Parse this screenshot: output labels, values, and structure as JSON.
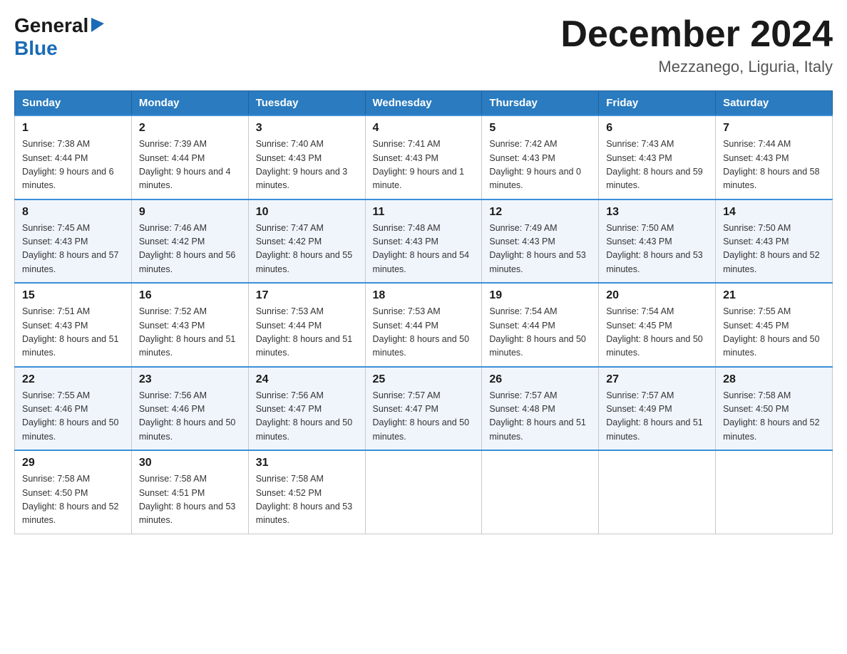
{
  "header": {
    "logo_general": "General",
    "logo_blue": "Blue",
    "month_title": "December 2024",
    "location": "Mezzanego, Liguria, Italy"
  },
  "days_of_week": [
    "Sunday",
    "Monday",
    "Tuesday",
    "Wednesday",
    "Thursday",
    "Friday",
    "Saturday"
  ],
  "weeks": [
    [
      {
        "day": "1",
        "sunrise": "7:38 AM",
        "sunset": "4:44 PM",
        "daylight": "9 hours and 6 minutes."
      },
      {
        "day": "2",
        "sunrise": "7:39 AM",
        "sunset": "4:44 PM",
        "daylight": "9 hours and 4 minutes."
      },
      {
        "day": "3",
        "sunrise": "7:40 AM",
        "sunset": "4:43 PM",
        "daylight": "9 hours and 3 minutes."
      },
      {
        "day": "4",
        "sunrise": "7:41 AM",
        "sunset": "4:43 PM",
        "daylight": "9 hours and 1 minute."
      },
      {
        "day": "5",
        "sunrise": "7:42 AM",
        "sunset": "4:43 PM",
        "daylight": "9 hours and 0 minutes."
      },
      {
        "day": "6",
        "sunrise": "7:43 AM",
        "sunset": "4:43 PM",
        "daylight": "8 hours and 59 minutes."
      },
      {
        "day": "7",
        "sunrise": "7:44 AM",
        "sunset": "4:43 PM",
        "daylight": "8 hours and 58 minutes."
      }
    ],
    [
      {
        "day": "8",
        "sunrise": "7:45 AM",
        "sunset": "4:43 PM",
        "daylight": "8 hours and 57 minutes."
      },
      {
        "day": "9",
        "sunrise": "7:46 AM",
        "sunset": "4:42 PM",
        "daylight": "8 hours and 56 minutes."
      },
      {
        "day": "10",
        "sunrise": "7:47 AM",
        "sunset": "4:42 PM",
        "daylight": "8 hours and 55 minutes."
      },
      {
        "day": "11",
        "sunrise": "7:48 AM",
        "sunset": "4:43 PM",
        "daylight": "8 hours and 54 minutes."
      },
      {
        "day": "12",
        "sunrise": "7:49 AM",
        "sunset": "4:43 PM",
        "daylight": "8 hours and 53 minutes."
      },
      {
        "day": "13",
        "sunrise": "7:50 AM",
        "sunset": "4:43 PM",
        "daylight": "8 hours and 53 minutes."
      },
      {
        "day": "14",
        "sunrise": "7:50 AM",
        "sunset": "4:43 PM",
        "daylight": "8 hours and 52 minutes."
      }
    ],
    [
      {
        "day": "15",
        "sunrise": "7:51 AM",
        "sunset": "4:43 PM",
        "daylight": "8 hours and 51 minutes."
      },
      {
        "day": "16",
        "sunrise": "7:52 AM",
        "sunset": "4:43 PM",
        "daylight": "8 hours and 51 minutes."
      },
      {
        "day": "17",
        "sunrise": "7:53 AM",
        "sunset": "4:44 PM",
        "daylight": "8 hours and 51 minutes."
      },
      {
        "day": "18",
        "sunrise": "7:53 AM",
        "sunset": "4:44 PM",
        "daylight": "8 hours and 50 minutes."
      },
      {
        "day": "19",
        "sunrise": "7:54 AM",
        "sunset": "4:44 PM",
        "daylight": "8 hours and 50 minutes."
      },
      {
        "day": "20",
        "sunrise": "7:54 AM",
        "sunset": "4:45 PM",
        "daylight": "8 hours and 50 minutes."
      },
      {
        "day": "21",
        "sunrise": "7:55 AM",
        "sunset": "4:45 PM",
        "daylight": "8 hours and 50 minutes."
      }
    ],
    [
      {
        "day": "22",
        "sunrise": "7:55 AM",
        "sunset": "4:46 PM",
        "daylight": "8 hours and 50 minutes."
      },
      {
        "day": "23",
        "sunrise": "7:56 AM",
        "sunset": "4:46 PM",
        "daylight": "8 hours and 50 minutes."
      },
      {
        "day": "24",
        "sunrise": "7:56 AM",
        "sunset": "4:47 PM",
        "daylight": "8 hours and 50 minutes."
      },
      {
        "day": "25",
        "sunrise": "7:57 AM",
        "sunset": "4:47 PM",
        "daylight": "8 hours and 50 minutes."
      },
      {
        "day": "26",
        "sunrise": "7:57 AM",
        "sunset": "4:48 PM",
        "daylight": "8 hours and 51 minutes."
      },
      {
        "day": "27",
        "sunrise": "7:57 AM",
        "sunset": "4:49 PM",
        "daylight": "8 hours and 51 minutes."
      },
      {
        "day": "28",
        "sunrise": "7:58 AM",
        "sunset": "4:50 PM",
        "daylight": "8 hours and 52 minutes."
      }
    ],
    [
      {
        "day": "29",
        "sunrise": "7:58 AM",
        "sunset": "4:50 PM",
        "daylight": "8 hours and 52 minutes."
      },
      {
        "day": "30",
        "sunrise": "7:58 AM",
        "sunset": "4:51 PM",
        "daylight": "8 hours and 53 minutes."
      },
      {
        "day": "31",
        "sunrise": "7:58 AM",
        "sunset": "4:52 PM",
        "daylight": "8 hours and 53 minutes."
      },
      null,
      null,
      null,
      null
    ]
  ]
}
